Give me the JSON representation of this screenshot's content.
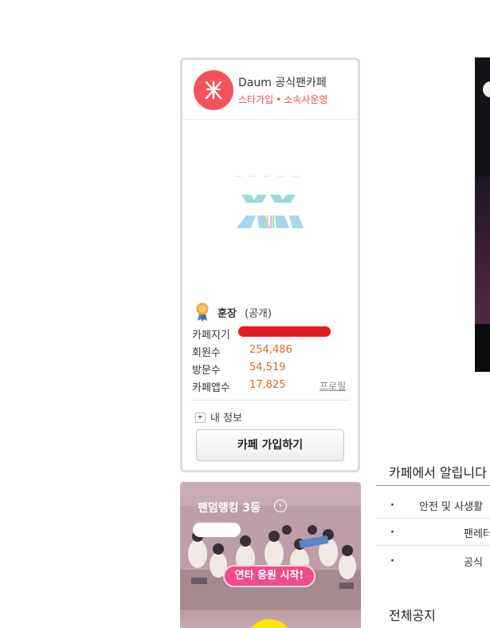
{
  "cafe": {
    "name": "Daum 공식팬카페",
    "sub_label_1": "스타가입",
    "sub_label_2": "소속사운영",
    "brand_color": "#f0545a",
    "icon": "daum-fancafe-icon",
    "grade_label": "훈장",
    "grade_status": "(공개)",
    "stats": {
      "owner_label": "카페지기",
      "members_label": "회원수",
      "members_value": "254,486",
      "visits_label": "방문수",
      "visits_value": "54,519",
      "app_label": "카페앱수",
      "app_value": "17,825",
      "value_color": "#d3702a"
    },
    "profile_link": "프로필",
    "my_info_label": "내 정보",
    "join_button": "카페 가입하기"
  },
  "banner": {
    "title": "팬덤랭킹 3등",
    "cheer_button": "연타 응원 시작!"
  },
  "notices": {
    "title": "카페에서 알립니다",
    "items": [
      {
        "bullet": "·",
        "text": "안전 및 사생활"
      },
      {
        "bullet": "·",
        "text": "팬레터"
      },
      {
        "bullet": "·",
        "text": "공식"
      }
    ],
    "all_title": "전체공지"
  }
}
